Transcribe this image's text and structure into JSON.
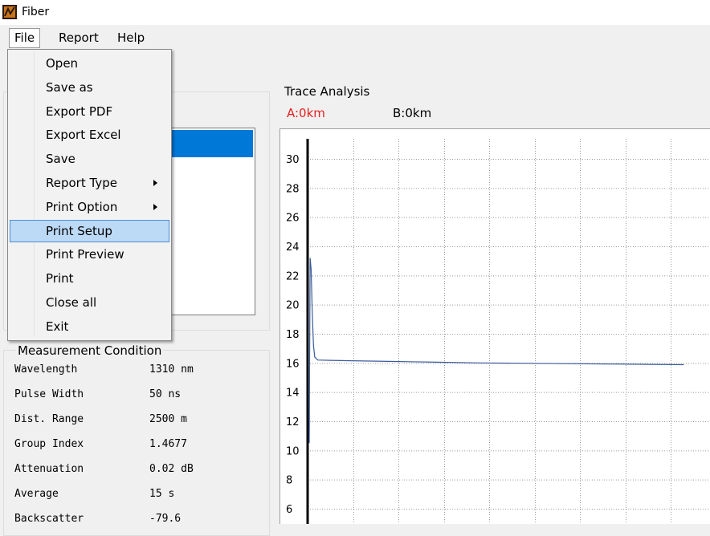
{
  "window": {
    "title": "Fiber"
  },
  "menubar": {
    "items": [
      "File",
      "Report",
      "Help"
    ]
  },
  "file_menu": {
    "items": [
      {
        "label": "Open",
        "submenu": false
      },
      {
        "label": "Save as",
        "submenu": false
      },
      {
        "label": "Export PDF",
        "submenu": false
      },
      {
        "label": "Export Excel",
        "submenu": false
      },
      {
        "label": "Save",
        "submenu": false
      },
      {
        "label": "Report Type",
        "submenu": true
      },
      {
        "label": "Print Option",
        "submenu": true
      },
      {
        "label": "Print Setup",
        "submenu": false,
        "highlighted": true
      },
      {
        "label": "Print Preview",
        "submenu": false
      },
      {
        "label": "Print",
        "submenu": false
      },
      {
        "label": "Close all",
        "submenu": false
      },
      {
        "label": "Exit",
        "submenu": false
      }
    ]
  },
  "measurement": {
    "title": "Measurement Condition",
    "rows": [
      {
        "label": "Wavelength",
        "value": "1310 nm"
      },
      {
        "label": "Pulse Width",
        "value": "50 ns"
      },
      {
        "label": "Dist. Range",
        "value": "2500 m"
      },
      {
        "label": "Group Index",
        "value": "1.4677"
      },
      {
        "label": "Attenuation",
        "value": "0.02 dB"
      },
      {
        "label": "Average",
        "value": "15 s"
      },
      {
        "label": "Backscatter",
        "value": "-79.6"
      }
    ]
  },
  "trace": {
    "title": "Trace Analysis",
    "marker_a": "A:0km",
    "marker_b": "B:0km",
    "marker_a_color": "#e82020",
    "trace_color": "#3a5a9a",
    "selection_color": "#0078d7"
  },
  "chart_data": {
    "type": "line",
    "ylim": [
      5,
      31
    ],
    "yticks": [
      6,
      8,
      10,
      12,
      14,
      16,
      18,
      20,
      22,
      24,
      26,
      28,
      30
    ],
    "grid": true,
    "series": [
      {
        "points": [
          [
            0,
            10.5
          ],
          [
            0.2,
            23.2
          ],
          [
            0.45,
            22.4
          ],
          [
            0.7,
            19.6
          ],
          [
            1.0,
            17.2
          ],
          [
            1.3,
            16.4
          ],
          [
            2,
            16.2
          ],
          [
            5,
            16.18
          ],
          [
            10,
            16.15
          ],
          [
            20,
            16.1
          ],
          [
            30,
            16.05
          ],
          [
            40,
            16.0
          ],
          [
            50,
            15.98
          ],
          [
            60,
            15.95
          ],
          [
            70,
            15.93
          ],
          [
            80,
            15.9
          ],
          [
            88,
            15.88
          ]
        ]
      }
    ]
  }
}
